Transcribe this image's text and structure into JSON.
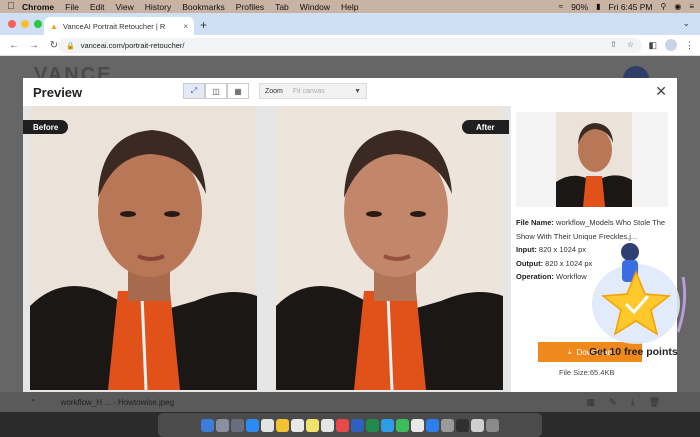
{
  "menubar": {
    "apple": "",
    "app": "Chrome",
    "items": [
      "File",
      "Edit",
      "View",
      "History",
      "Bookmarks",
      "Profiles",
      "Tab",
      "Window",
      "Help"
    ],
    "battery": "90%",
    "clock": "Fri 6:45 PM"
  },
  "browser": {
    "tab_title": "VanceAI Portrait Retoucher | R",
    "new_tab": "+",
    "url": "vanceai.com/portrait-retoucher/"
  },
  "site": {
    "logo": "VANCE"
  },
  "modal": {
    "title": "Preview",
    "zoom_label": "Zoom",
    "zoom_value": "Fit canvas",
    "before_label": "Before",
    "after_label": "After",
    "info": {
      "file_name_label": "File Name:",
      "file_name_value": "workflow_Models Who Stole The Show With Their Unique Freckles.j...",
      "input_label": "Input:",
      "input_value": "820 x 1024 px",
      "output_label": "Output:",
      "output_value": "820 x 1024 px",
      "operation_label": "Operation:",
      "operation_value": "Workflow"
    },
    "download_label": "Download",
    "file_size": "File Size:65.4KB"
  },
  "promo": {
    "text": "Get 10 free points"
  },
  "shelf": {
    "file": "workflow_H ... - Howtowise.jpeg"
  },
  "colors": {
    "accent_orange": "#f0891b",
    "chrome_blue": "#cfe0f5",
    "tag_dark": "#1f1f1f"
  }
}
